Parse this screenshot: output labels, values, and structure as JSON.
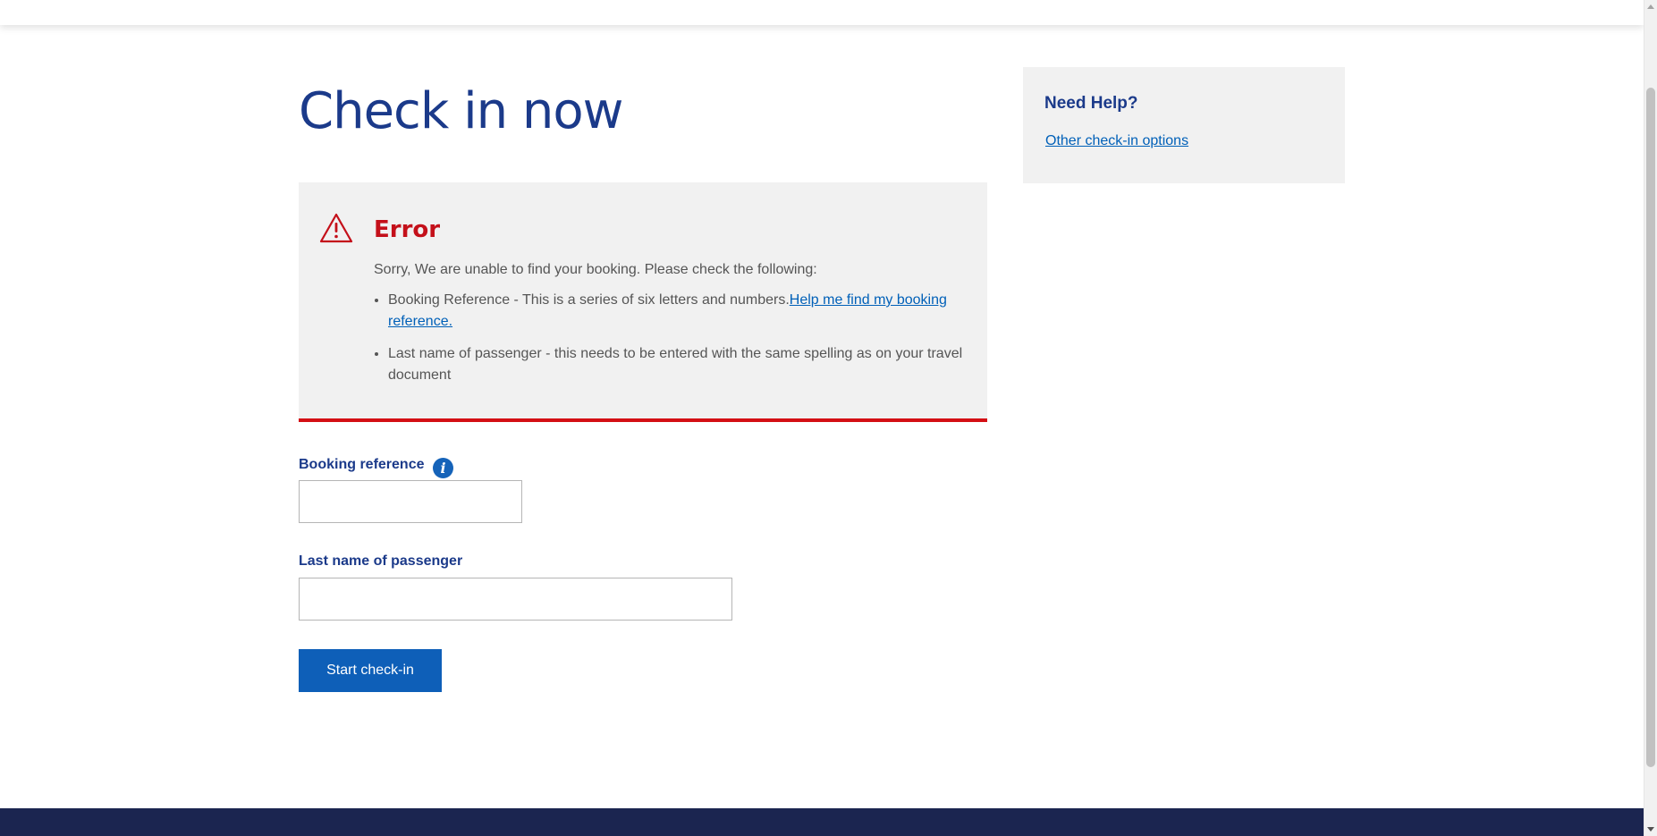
{
  "page": {
    "title": "Check in now"
  },
  "error": {
    "heading": "Error",
    "intro": "Sorry, We are unable to find your booking. Please check the following:",
    "items": [
      {
        "text": "Booking Reference - This is a series of six letters and numbers.",
        "link": "Help me find my booking reference."
      },
      {
        "text": "Last name of passenger - this needs to be entered with the same spelling as on your travel document"
      }
    ]
  },
  "help": {
    "title": "Need Help?",
    "link": "Other check-in options"
  },
  "form": {
    "booking_label": "Booking reference",
    "booking_value": "",
    "lastname_label": "Last name of passenger",
    "lastname_value": "",
    "submit_label": "Start check-in"
  },
  "icons": {
    "error": "warning-triangle-icon",
    "info": "info-icon"
  },
  "colors": {
    "brand_navy": "#1b3a8a",
    "link_blue": "#0060b8",
    "error_red": "#d40f14",
    "button_blue": "#0e5fb8",
    "panel_grey": "#f1f1f1",
    "footer_navy": "#1b2550"
  }
}
